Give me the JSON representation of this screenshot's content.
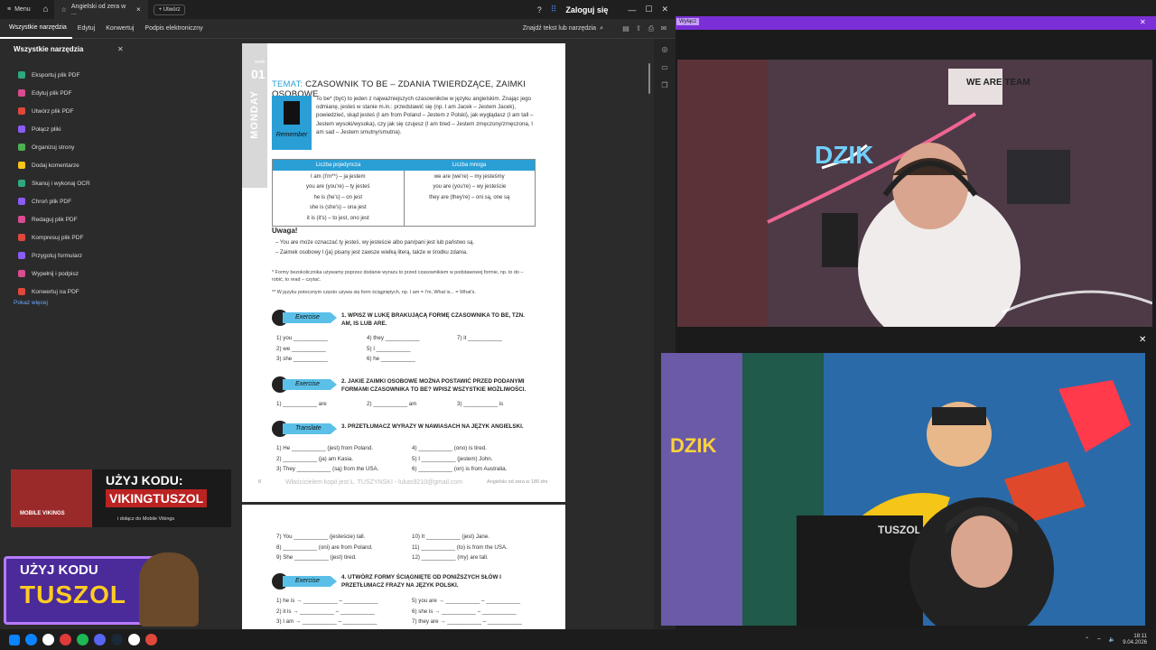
{
  "titlebar": {
    "menu_label": "Menu",
    "tab_title": "Angielski od zera w ...",
    "new_tab_label": "Utwórz",
    "login_label": "Zaloguj się"
  },
  "toolbar": {
    "tabs": [
      "Wszystkie narzędzia",
      "Edytuj",
      "Konwertuj",
      "Podpis elektroniczny"
    ],
    "find_label": "Znajdź tekst lub narzędzia"
  },
  "sidepanel": {
    "title": "Wszystkie narzędzia",
    "items": [
      {
        "label": "Eksportuj plik PDF",
        "color": "#2ea97d"
      },
      {
        "label": "Edytuj plik PDF",
        "color": "#d94c8f"
      },
      {
        "label": "Utwórz plik PDF",
        "color": "#e0483b"
      },
      {
        "label": "Połącz pliki",
        "color": "#8b5cf6"
      },
      {
        "label": "Organizuj strony",
        "color": "#4caf50"
      },
      {
        "label": "Dodaj komentarze",
        "color": "#f5c518"
      },
      {
        "label": "Skanuj i wykonaj OCR",
        "color": "#2ea97d"
      },
      {
        "label": "Chroń plik PDF",
        "color": "#8b5cf6"
      },
      {
        "label": "Redaguj plik PDF",
        "color": "#d94c8f"
      },
      {
        "label": "Kompresuj plik PDF",
        "color": "#e0483b"
      },
      {
        "label": "Przygotuj formularz",
        "color": "#8b5cf6"
      },
      {
        "label": "Wypełnij i podpisz",
        "color": "#d94c8f"
      },
      {
        "label": "Konwertuj na PDF",
        "color": "#e0483b"
      }
    ],
    "more_label": "Pokaż więcej"
  },
  "page1": {
    "week_label": "week",
    "day_number": "01",
    "day_name": "MONDAY",
    "title_prefix": "TEMAT:",
    "title_text": "CZASOWNIK TO BE – ZDANIA TWIERDZĄCE, ZAIMKI OSOBOWE",
    "remember_label": "Remember",
    "intro": "To be* (być) to jeden z najważniejszych czasowników w języku angielskim. Znając jego odmianę, jesteś w stanie m.in.: przedstawić się (np. I am Jacek – Jestem Jacek), powiedzieć, skąd jesteś (I am from Poland – Jestem z Polski), jak wyglądasz (I am tall – Jestem wysoki/wysoka), czy jak się czujesz (I am tired – Jestem zmęczony/zmęczona, I am sad – Jestem smutny/smutna).",
    "table": {
      "headers": [
        "Liczba pojedyncza",
        "Liczba mnoga"
      ],
      "singular": [
        "I am (I'm**) – ja jestem",
        "you are (you're) – ty jesteś",
        "he is (he's) – on jest",
        "she is (she's) – ona jest",
        "it is (it's) – to jest, ono jest"
      ],
      "plural": [
        "we are (we're) – my jesteśmy",
        "you are (you're) – wy jesteście",
        "they are (they're) – oni są, one są"
      ]
    },
    "uwaga_title": "Uwaga!",
    "uwaga_notes": [
      "You are może oznaczać ty jesteś, wy jesteście albo pan/pani jest lub państwo są.",
      "Zaimek osobowy I (ja) pisany jest zawsze wielką literą, także w środku zdania."
    ],
    "footnote1": "* Formy bezokolicznika używamy poprzez dodanie wyrazu to przed czasownikiem w podstawowej formie, np. to do – robić, to read – czytać.",
    "footnote2": "** W języku potocznym często używa się form ściągniętych, np. I am = I'm, What is... = What's.",
    "exercise_label": "Exercise",
    "translate_label": "Translate",
    "ex1_title": "1. WPISZ W LUKĘ BRAKUJĄCĄ FORMĘ CZASOWNIKA TO BE, TZN. AM, IS LUB ARE.",
    "ex1_rows": [
      [
        "1) you ___________",
        "4) they ___________",
        "7) it ___________"
      ],
      [
        "2) we ___________",
        "5) I ___________",
        ""
      ],
      [
        "3) she ___________",
        "6) he ___________",
        ""
      ]
    ],
    "ex2_title": "2. JAKIE ZAIMKI OSOBOWE MOŻNA POSTAWIĆ PRZED PODANYMI FORMAMI CZASOWNIKA TO BE? WPISZ WSZYSTKIE MOŻLIWOŚCI.",
    "ex2_row": [
      "1) ___________ are",
      "2) ___________ am",
      "3) ___________ is"
    ],
    "ex3_title": "3. PRZETŁUMACZ WYRAZY W NAWIASACH NA JĘZYK ANGIELSKI.",
    "ex3_rows": [
      [
        "1) He ___________ (jest) from Poland.",
        "4) ___________ (ono) is tired."
      ],
      [
        "2) ___________ (ja) am Kasia.",
        "5) I ___________ (jestem) John."
      ],
      [
        "3) They ___________ (są) from the USA.",
        "6) ___________ (on) is from Australia."
      ]
    ],
    "page_number": "8",
    "watermark": "Właścicielem kopii jest Ł. TUSZYNSKI - lukas9210@gmail.com",
    "footer_right": "Angielski od zera w 180 dni"
  },
  "page2": {
    "rows": [
      [
        "7) You ___________ (jesteście) tall.",
        "10) It ___________ (jest) Jane."
      ],
      [
        "8) ___________ (oni) are from Poland.",
        "11) ___________ (to) is from the USA."
      ],
      [
        "9) She ___________ (jest) tired.",
        "12) ___________ (my) are tall."
      ]
    ],
    "ex4_title": "4. UTWÓRZ FORMY ŚCIĄGNIĘTE OD PONIŻSZYCH SŁÓW I PRZETŁUMACZ FRAZY NA JĘZYK POLSKI.",
    "ex4_rows": [
      [
        "1) he is → ___________ – ___________",
        "5) you are → ___________ – ___________"
      ],
      [
        "2) it is → ___________ – ___________",
        "6) she is → ___________ – ___________"
      ],
      [
        "3) I am → ___________ – ___________",
        "7) they are → ___________ – ___________"
      ]
    ]
  },
  "stream": {
    "bar_label": "Wyłącz",
    "cam1_signs": [
      "DZIK",
      "WE ARE TEAM"
    ],
    "cam2_signs": [
      "DZIK",
      "TUSZOL"
    ]
  },
  "promo1": {
    "title": "UŻYJ KODU:",
    "code": "VIKINGTUSZOL",
    "subtitle": "i dołącz do Mobile Vikings",
    "brand": "MOBILE VIKINGS"
  },
  "promo2": {
    "line1": "UŻYJ KODU",
    "line2": "TUSZOL"
  },
  "taskbar": {
    "time": "18:11",
    "date": "9.04.2026",
    "apps": [
      "#0a84ff",
      "#ffffff",
      "#e03a3a",
      "#1db954",
      "#5865f2",
      "#1b2838",
      "#ffffff",
      "#e0483b"
    ]
  }
}
